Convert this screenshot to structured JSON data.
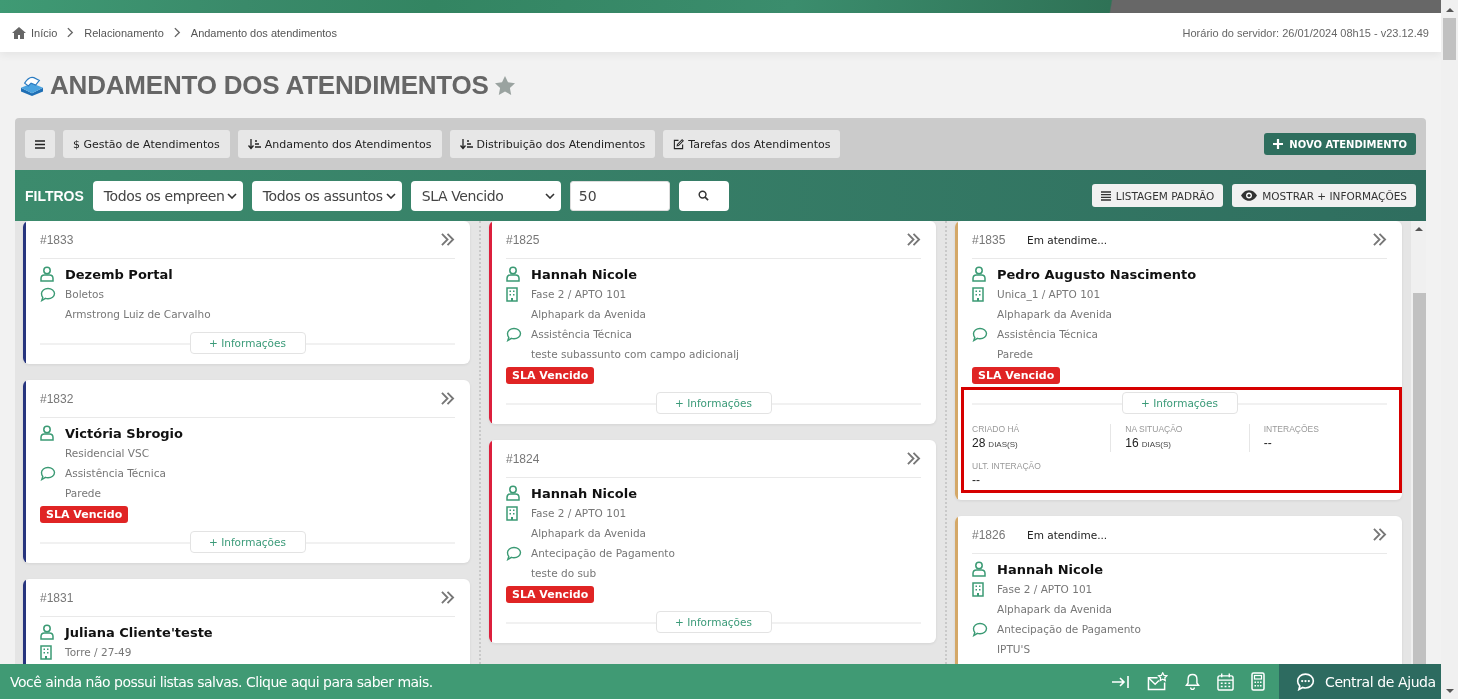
{
  "breadcrumb": {
    "items": [
      "Início",
      "Relacionamento",
      "Andamento dos atendimentos"
    ],
    "server_info": "Horário do servidor: 26/01/2024 08h15 - v23.12.49"
  },
  "page_title": "ANDAMENTO DOS ATENDIMENTOS",
  "toolbar": {
    "buttons": [
      {
        "kind": "menu"
      },
      {
        "kind": "plain",
        "label": "$ Gestão de Atendimentos"
      },
      {
        "kind": "sort",
        "label": "Andamento dos Atendimentos"
      },
      {
        "kind": "sort",
        "label": "Distribuição dos Atendimentos"
      },
      {
        "kind": "edit",
        "label": "Tarefas dos Atendimentos"
      }
    ],
    "new_button": "NOVO ATENDIMENTO"
  },
  "filters": {
    "label": "FILTROS",
    "selects": [
      "Todos os empreen",
      "Todos os assuntos",
      "SLA Vencido"
    ],
    "quantity": "50",
    "list_button": "LISTAGEM PADRÃO",
    "more_button": "MOSTRAR + INFORMAÇÕES"
  },
  "board": {
    "columns": [
      {
        "color": "#27357e",
        "cards": [
          {
            "number": "#1833",
            "name": "Dezemb Portal",
            "lines": [
              {
                "kind": "chat",
                "text": "Boletos"
              },
              {
                "kind": "plain",
                "text": "Armstrong Luiz de Carvalho"
              }
            ],
            "more": "+ Informações",
            "expanded": false
          },
          {
            "number": "#1832",
            "name": "Victória Sbrogio",
            "lines": [
              {
                "kind": "plain",
                "text": "Residencial VSC"
              },
              {
                "kind": "chat",
                "text": "Assistência Técnica"
              },
              {
                "kind": "plain",
                "text": "Parede"
              }
            ],
            "sla": "SLA Vencido",
            "more": "+ Informações",
            "expanded": false
          },
          {
            "number": "#1831",
            "name": "Juliana Cliente'teste",
            "lines": [
              {
                "kind": "building",
                "text": "Torre / 27-49"
              }
            ],
            "expanded": false
          }
        ]
      },
      {
        "color": "#dc1f3c",
        "cards": [
          {
            "number": "#1825",
            "name": "Hannah Nicole",
            "lines": [
              {
                "kind": "building",
                "text": "Fase 2 / APTO 101"
              },
              {
                "kind": "plain",
                "text": "Alphapark da Avenida"
              },
              {
                "kind": "chat",
                "text": "Assistência Técnica"
              },
              {
                "kind": "plain",
                "text": "teste subassunto com campo adicionalj"
              }
            ],
            "sla": "SLA Vencido",
            "more": "+ Informações",
            "expanded": false
          },
          {
            "number": "#1824",
            "name": "Hannah Nicole",
            "lines": [
              {
                "kind": "building",
                "text": "Fase 2 / APTO 101"
              },
              {
                "kind": "plain",
                "text": "Alphapark da Avenida"
              },
              {
                "kind": "chat",
                "text": "Antecipação de Pagamento"
              },
              {
                "kind": "plain",
                "text": "teste do sub"
              }
            ],
            "sla": "SLA Vencido",
            "more": "+ Informações",
            "expanded": false
          }
        ]
      },
      {
        "color": "#d4a868",
        "cards": [
          {
            "number": "#1835",
            "status": "Em atendime...",
            "name": "Pedro Augusto Nascimento",
            "lines": [
              {
                "kind": "building",
                "text": "Unica_1 / APTO 101"
              },
              {
                "kind": "plain",
                "text": "Alphapark da Avenida"
              },
              {
                "kind": "chat",
                "text": "Assistência Técnica"
              },
              {
                "kind": "plain",
                "text": "Parede"
              }
            ],
            "sla": "SLA Vencido",
            "more": "+ Informações",
            "expanded": true,
            "highlighted": true,
            "details": {
              "stats": [
                {
                  "label": "CRIADO HÁ",
                  "value": "28",
                  "unit": "DIAS(S)"
                },
                {
                  "label": "NA SITUAÇÃO",
                  "value": "16",
                  "unit": "DIAS(S)"
                },
                {
                  "label": "INTERAÇÕES",
                  "value": "--"
                }
              ],
              "last_label": "ULT. INTERAÇÃO",
              "last_value": "--"
            }
          },
          {
            "number": "#1826",
            "status": "Em atendime...",
            "name": "Hannah Nicole",
            "lines": [
              {
                "kind": "building",
                "text": "Fase 2 / APTO 101"
              },
              {
                "kind": "plain",
                "text": "Alphapark da Avenida"
              },
              {
                "kind": "chat",
                "text": "Antecipação de Pagamento"
              },
              {
                "kind": "plain",
                "text": "IPTU'S"
              }
            ],
            "expanded": false
          }
        ]
      }
    ]
  },
  "footer": {
    "message": "Você ainda não possui listas salvas. Clique aqui para saber mais.",
    "help": "Central de Ajuda"
  }
}
